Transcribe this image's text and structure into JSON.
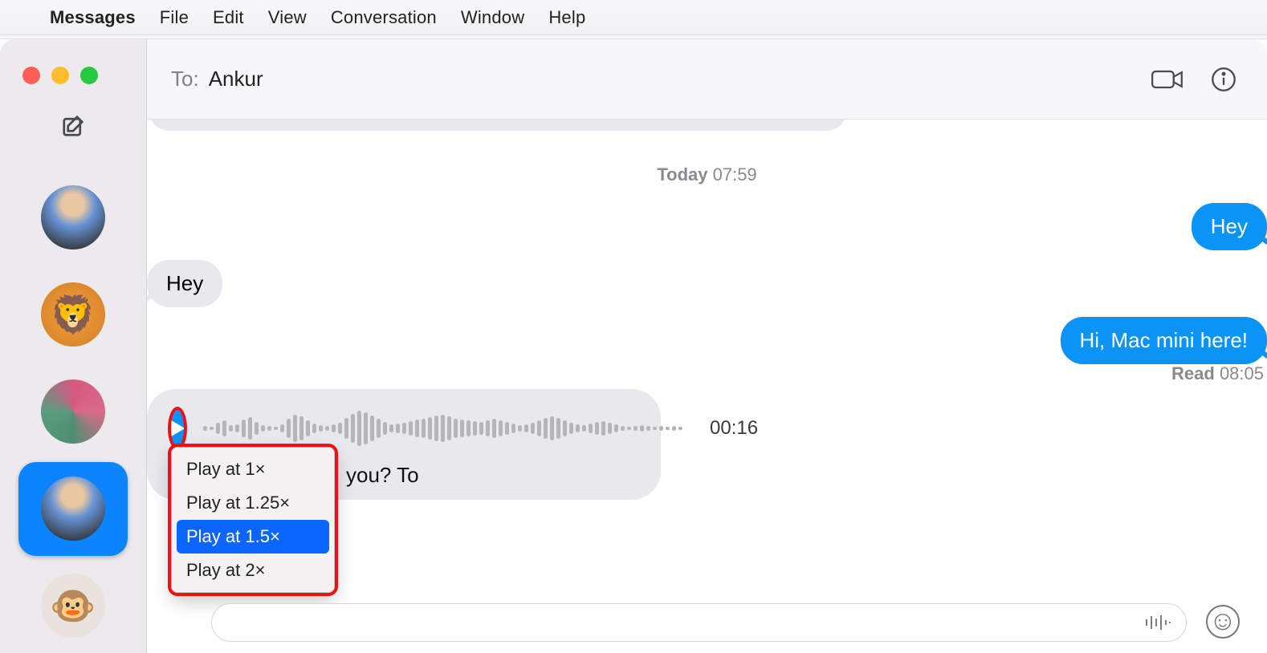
{
  "menubar": {
    "app_name": "Messages",
    "items": [
      "File",
      "Edit",
      "View",
      "Conversation",
      "Window",
      "Help"
    ]
  },
  "sidebar": {
    "conversations": [
      {
        "id": "conv-1",
        "avatar": "person1"
      },
      {
        "id": "conv-2",
        "avatar": "lion"
      },
      {
        "id": "conv-3",
        "avatar": "swirl"
      },
      {
        "id": "conv-4",
        "avatar": "person1",
        "selected": true
      },
      {
        "id": "conv-5",
        "avatar": "monkey"
      }
    ]
  },
  "header": {
    "to_label": "To:",
    "to_name": "Ankur"
  },
  "conversation": {
    "timestamp_label": "Today",
    "timestamp_time": "07:59",
    "messages": [
      {
        "side": "sent",
        "text": "Hey"
      },
      {
        "side": "recv",
        "text": "Hey"
      },
      {
        "side": "sent",
        "text": "Hi, Mac mini here!"
      }
    ],
    "read_receipt": {
      "label": "Read",
      "time": "08:05"
    },
    "audio": {
      "duration": "00:16",
      "transcript_visible_tail": "you? To"
    }
  },
  "context_menu": {
    "items": [
      {
        "label": "Play at 1×"
      },
      {
        "label": "Play at 1.25×"
      },
      {
        "label": "Play at 1.5×",
        "selected": true
      },
      {
        "label": "Play at 2×"
      }
    ]
  },
  "colors": {
    "accent": "#0b93f6",
    "highlight": "#e11"
  }
}
